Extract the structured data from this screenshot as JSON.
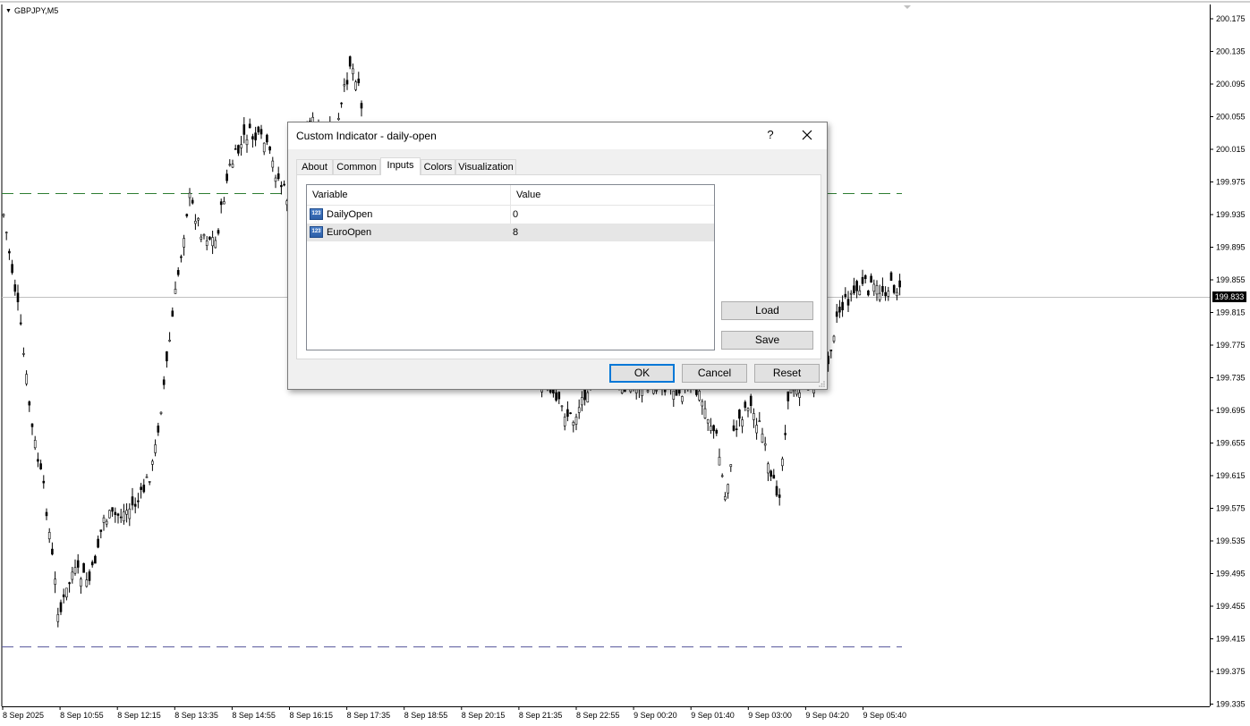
{
  "chart": {
    "symbol": "GBPJPY,M5",
    "current_price": "199.833",
    "price_labels": [
      "200.175",
      "200.135",
      "200.095",
      "200.055",
      "200.015",
      "199.975",
      "199.935",
      "199.895",
      "199.855",
      "199.815",
      "199.775",
      "199.735",
      "199.695",
      "199.655",
      "199.615",
      "199.575",
      "199.535",
      "199.495",
      "199.455",
      "199.415",
      "199.375",
      "199.335"
    ],
    "time_labels": [
      "8 Sep 2025",
      "8 Sep 10:55",
      "8 Sep 12:15",
      "8 Sep 13:35",
      "8 Sep 14:55",
      "8 Sep 16:15",
      "8 Sep 17:35",
      "8 Sep 18:55",
      "8 Sep 20:15",
      "8 Sep 21:35",
      "8 Sep 22:55",
      "9 Sep 00:20",
      "9 Sep 01:40",
      "9 Sep 03:00",
      "9 Sep 04:20",
      "9 Sep 05:40"
    ],
    "colors": {
      "candle": "#000000",
      "daily_open_line": "#2e7d32",
      "euro_open_line": "#5b5b9e",
      "price_line": "#c0c0c0"
    }
  },
  "dialog": {
    "title": "Custom Indicator - daily-open",
    "help": "?",
    "tabs": [
      {
        "label": "About"
      },
      {
        "label": "Common"
      },
      {
        "label": "Inputs"
      },
      {
        "label": "Colors"
      },
      {
        "label": "Visualization"
      }
    ],
    "active_tab": "Inputs",
    "grid": {
      "headers": {
        "variable": "Variable",
        "value": "Value"
      },
      "rows": [
        {
          "icon": "123",
          "variable": "DailyOpen",
          "value": "0"
        },
        {
          "icon": "123",
          "variable": "EuroOpen",
          "value": "8"
        }
      ]
    },
    "buttons": {
      "load": "Load",
      "save": "Save",
      "ok": "OK",
      "cancel": "Cancel",
      "reset": "Reset"
    }
  }
}
